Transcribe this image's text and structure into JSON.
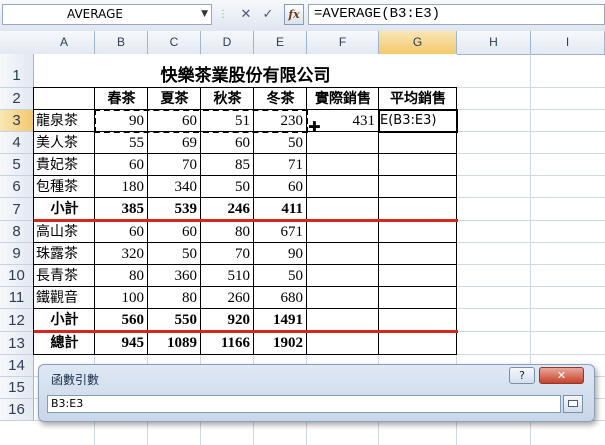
{
  "formula_bar": {
    "name_box": "AVERAGE",
    "formula": "=AVERAGE(B3:E3)",
    "cancel_glyph": "✕",
    "enter_glyph": "✓",
    "fx_label": "fx"
  },
  "columns": [
    "A",
    "B",
    "C",
    "D",
    "E",
    "F",
    "G",
    "H",
    "I"
  ],
  "rows": [
    "1",
    "2",
    "3",
    "4",
    "5",
    "6",
    "7",
    "8",
    "9",
    "10",
    "11",
    "12",
    "13",
    "14",
    "15",
    "16"
  ],
  "sheet": {
    "title": "快樂茶業股份有限公司",
    "headers": [
      "春茶",
      "夏茶",
      "秋茶",
      "冬茶",
      "實際銷售",
      "平均銷售"
    ],
    "data_rows": [
      {
        "name": "龍泉茶",
        "values": [
          "90",
          "60",
          "51",
          "230"
        ],
        "f": "431",
        "g": "E(B3:E3)"
      },
      {
        "name": "美人茶",
        "values": [
          "55",
          "69",
          "60",
          "50"
        ],
        "f": "",
        "g": ""
      },
      {
        "name": "貴妃茶",
        "values": [
          "60",
          "70",
          "85",
          "71"
        ],
        "f": "",
        "g": ""
      },
      {
        "name": "包種茶",
        "values": [
          "180",
          "340",
          "50",
          "60"
        ],
        "f": "",
        "g": ""
      },
      {
        "name": "小計",
        "values": [
          "385",
          "539",
          "246",
          "411"
        ],
        "f": "",
        "g": ""
      },
      {
        "name": "高山茶",
        "values": [
          "60",
          "60",
          "80",
          "671"
        ],
        "f": "",
        "g": ""
      },
      {
        "name": "珠露茶",
        "values": [
          "320",
          "50",
          "70",
          "90"
        ],
        "f": "",
        "g": ""
      },
      {
        "name": "長青茶",
        "values": [
          "80",
          "360",
          "510",
          "50"
        ],
        "f": "",
        "g": ""
      },
      {
        "name": "鐵觀音",
        "values": [
          "100",
          "80",
          "260",
          "680"
        ],
        "f": "",
        "g": ""
      },
      {
        "name": "小計",
        "values": [
          "560",
          "550",
          "920",
          "1491"
        ],
        "f": "",
        "g": ""
      },
      {
        "name": "總計",
        "values": [
          "945",
          "1089",
          "1166",
          "1902"
        ],
        "f": "",
        "g": ""
      }
    ]
  },
  "dialog": {
    "title": "函數引數",
    "help_label": "?",
    "close_label": "✕",
    "input_value": "B3:E3"
  },
  "colors": {
    "grid": "#d0d7e5",
    "header_bg": "#e3e9f2",
    "selected_header": "#f3c96e",
    "subtotal_line": "#d9261c",
    "marquee": "#000000"
  }
}
